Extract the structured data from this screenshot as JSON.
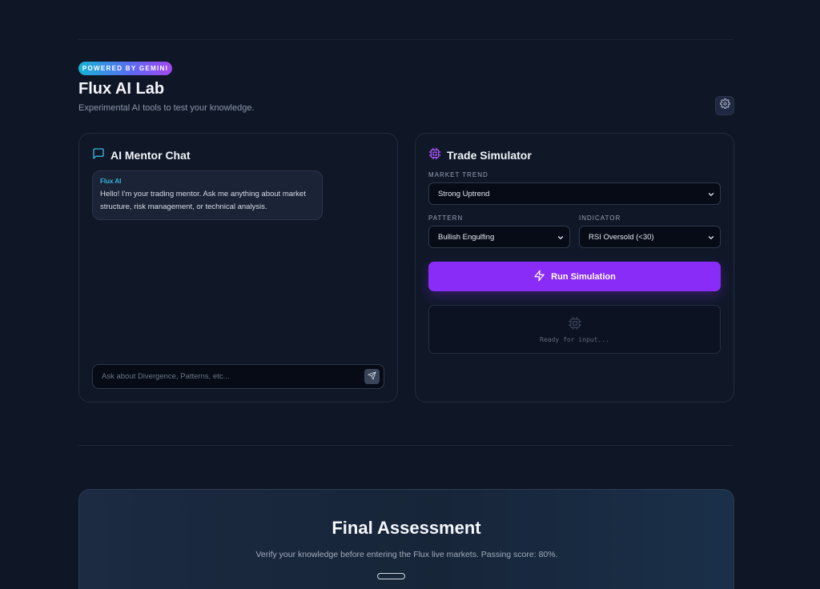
{
  "header": {
    "badge": "POWERED BY GEMINI",
    "title": "Flux AI Lab",
    "subtitle": "Experimental AI tools to test your knowledge."
  },
  "chat": {
    "title": "AI Mentor Chat",
    "message": {
      "author": "Flux AI",
      "text": "Hello! I'm your trading mentor. Ask me anything about market structure, risk management, or technical analysis."
    },
    "input_placeholder": "Ask about Divergence, Patterns, etc..."
  },
  "simulator": {
    "title": "Trade Simulator",
    "market_trend": {
      "label": "MARKET TREND",
      "value": "Strong Uptrend"
    },
    "pattern": {
      "label": "PATTERN",
      "value": "Bullish Engulfing"
    },
    "indicator": {
      "label": "INDICATOR",
      "value": "RSI Oversold (<30)"
    },
    "run_label": "Run Simulation",
    "output_status": "Ready for input..."
  },
  "assessment": {
    "title": "Final Assessment",
    "text": "Verify your knowledge before entering the Flux live markets. Passing score: 80%."
  },
  "colors": {
    "background": "#0f1626",
    "accent_purple": "#8a2cf7",
    "accent_cyan": "#36b6dd",
    "card_bg": "#101828"
  },
  "icons": {
    "settings": "gear-icon",
    "chat": "chat-bubble-icon",
    "simulator": "cpu-chip-icon",
    "send": "send-icon",
    "run": "lightning-icon"
  }
}
